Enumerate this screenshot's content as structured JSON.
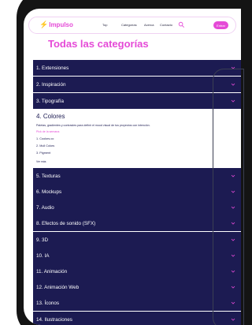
{
  "nav": {
    "logo": "Impulso",
    "links": [
      "Top",
      "Categorías",
      "Acerca",
      "Contacto"
    ],
    "cta": "Entrar"
  },
  "page_title": "Todas las categorías",
  "categories": [
    {
      "label": "1. Extensiones"
    },
    {
      "label": "2. Inspiración"
    },
    {
      "label": "3. Tipografía"
    },
    {
      "label": "4. Colores"
    },
    {
      "label": "5. Texturas"
    },
    {
      "label": "6. Mockups"
    },
    {
      "label": "7. Audio"
    },
    {
      "label": "8. Efectos de sonido (SFX)"
    },
    {
      "label": "9. 3D"
    },
    {
      "label": "10. IA"
    },
    {
      "label": "11. Animación"
    },
    {
      "label": "12. Animación Web"
    },
    {
      "label": "13. Íconos"
    },
    {
      "label": "14. Ilustraciones"
    }
  ],
  "expanded": {
    "description": "Paletas, gradientes y contrastes para definir el mood visual de tus proyectos con intención.",
    "pick_link": "Pick de la semana",
    "items": [
      "1. Coolors.co",
      "2. Mull Colors",
      "3. Pigment"
    ],
    "more": "Ver más"
  },
  "colors": {
    "accent": "#e54ad7",
    "row_bg": "#1c1b52",
    "device": "#141414"
  }
}
